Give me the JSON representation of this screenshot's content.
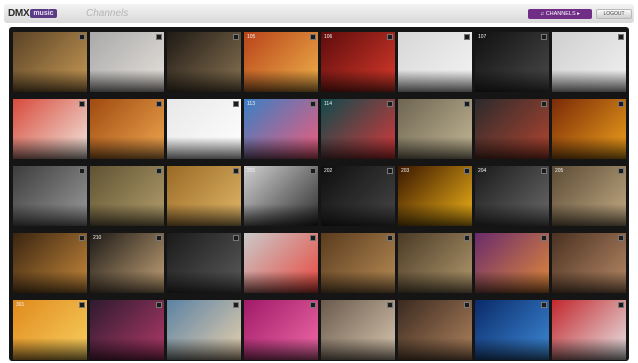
{
  "header": {
    "logo_text": "DMX",
    "logo_badge": "music",
    "page_title": "Channels",
    "primary_button": "♫ CHANNELS ▸",
    "secondary_button": "LOGOUT"
  },
  "tiles": [
    {
      "art": "sports-ball-icon",
      "c1": "#5a4326",
      "c2": "#c89a55"
    },
    {
      "art": "woman-portrait-icon",
      "c1": "#a9a9a9",
      "c2": "#e6e1dc"
    },
    {
      "art": "crowd-hands-icon",
      "c1": "#1f1a15",
      "c2": "#8a7453"
    },
    {
      "art": "sunset-city-icon",
      "c1": "#b8431a",
      "c2": "#f0b24a",
      "num": "105"
    },
    {
      "art": "red-abstract-icon",
      "c1": "#5e0c0c",
      "c2": "#d83a2b",
      "num": "106"
    },
    {
      "art": "man-in-suit-icon",
      "c1": "#d7d7d7",
      "c2": "#f4f4f4"
    },
    {
      "art": "dancer-icon",
      "c1": "#101010",
      "c2": "#4a4a4a",
      "num": "107"
    },
    {
      "art": "headphones-woman-icon",
      "c1": "#cfcfcf",
      "c2": "#f2f2f2"
    },
    {
      "art": "red-hair-woman-icon",
      "c1": "#d84a3c",
      "c2": "#f2e8df"
    },
    {
      "art": "party-crowd-icon",
      "c1": "#a04a10",
      "c2": "#f0a850"
    },
    {
      "art": "figure-red-icon",
      "c1": "#e8e8e8",
      "c2": "#ffffff"
    },
    {
      "art": "skyline-icon",
      "c1": "#3a7fc4",
      "c2": "#f25b7a",
      "num": "113"
    },
    {
      "art": "red-heart-icon",
      "c1": "#0f4a4c",
      "c2": "#d8383a",
      "num": "114"
    },
    {
      "art": "vintage-couple-icon",
      "c1": "#6e6552",
      "c2": "#c4b896"
    },
    {
      "art": "street-hat-icon",
      "c1": "#2b2b2b",
      "c2": "#b34430"
    },
    {
      "art": "orange-light-icon",
      "c1": "#7a2a07",
      "c2": "#f0a21c"
    },
    {
      "art": "guitar-icon",
      "c1": "#3c3c3c",
      "c2": "#9c9c9c"
    },
    {
      "art": "landscape-icon",
      "c1": "#5f5333",
      "c2": "#b59f6c"
    },
    {
      "art": "lion-icon",
      "c1": "#9a6a25",
      "c2": "#e2b86a"
    },
    {
      "art": "man-silhouette-icon",
      "c1": "#cfcfcf",
      "c2": "#2c2c2c",
      "num": "201"
    },
    {
      "art": "man-portrait-icon",
      "c1": "#0e0e0e",
      "c2": "#474747",
      "num": "202"
    },
    {
      "art": "concert-icon",
      "c1": "#3a1700",
      "c2": "#f1b418",
      "num": "203"
    },
    {
      "art": "masked-man-icon",
      "c1": "#1a1a1a",
      "c2": "#6b6b6b",
      "num": "204"
    },
    {
      "art": "hat-icon",
      "c1": "#5b4a35",
      "c2": "#c4ac84",
      "num": "205"
    },
    {
      "art": "guitar-player-icon",
      "c1": "#3a2410",
      "c2": "#c88a3c"
    },
    {
      "art": "woman-blonde-icon",
      "c1": "#1d1a16",
      "c2": "#c7a57a",
      "num": "210"
    },
    {
      "art": "singer-icon",
      "c1": "#1a1a1a",
      "c2": "#5b5b5b"
    },
    {
      "art": "red-box-icon",
      "c1": "#c9c9c9",
      "c2": "#e9473d"
    },
    {
      "art": "country-house-icon",
      "c1": "#5a3b1e",
      "c2": "#b88d55"
    },
    {
      "art": "piano-icon",
      "c1": "#4a3a26",
      "c2": "#b39a6e"
    },
    {
      "art": "woman-violet-icon",
      "c1": "#6a2b6c",
      "c2": "#e28a3a"
    },
    {
      "art": "accordion-icon",
      "c1": "#4a3122",
      "c2": "#b98a66"
    },
    {
      "art": "christ-statue-icon",
      "c1": "#e08a1c",
      "c2": "#f8d060",
      "num": "301"
    },
    {
      "art": "dancers-icon",
      "c1": "#2e1a2e",
      "c2": "#b23a6a"
    },
    {
      "art": "beach-icon",
      "c1": "#5b82a4",
      "c2": "#e9d1ad"
    },
    {
      "art": "carnival-icon",
      "c1": "#a01a68",
      "c2": "#f06aa8"
    },
    {
      "art": "couple-icon",
      "c1": "#6a5a4c",
      "c2": "#d8c7b0"
    },
    {
      "art": "dance-couple-icon",
      "c1": "#3b2a20",
      "c2": "#b0835e"
    },
    {
      "art": "blue-stage-icon",
      "c1": "#0a2a6a",
      "c2": "#3d8ad8"
    },
    {
      "art": "red-chairs-icon",
      "c1": "#c1272d",
      "c2": "#e9e9e9"
    }
  ]
}
